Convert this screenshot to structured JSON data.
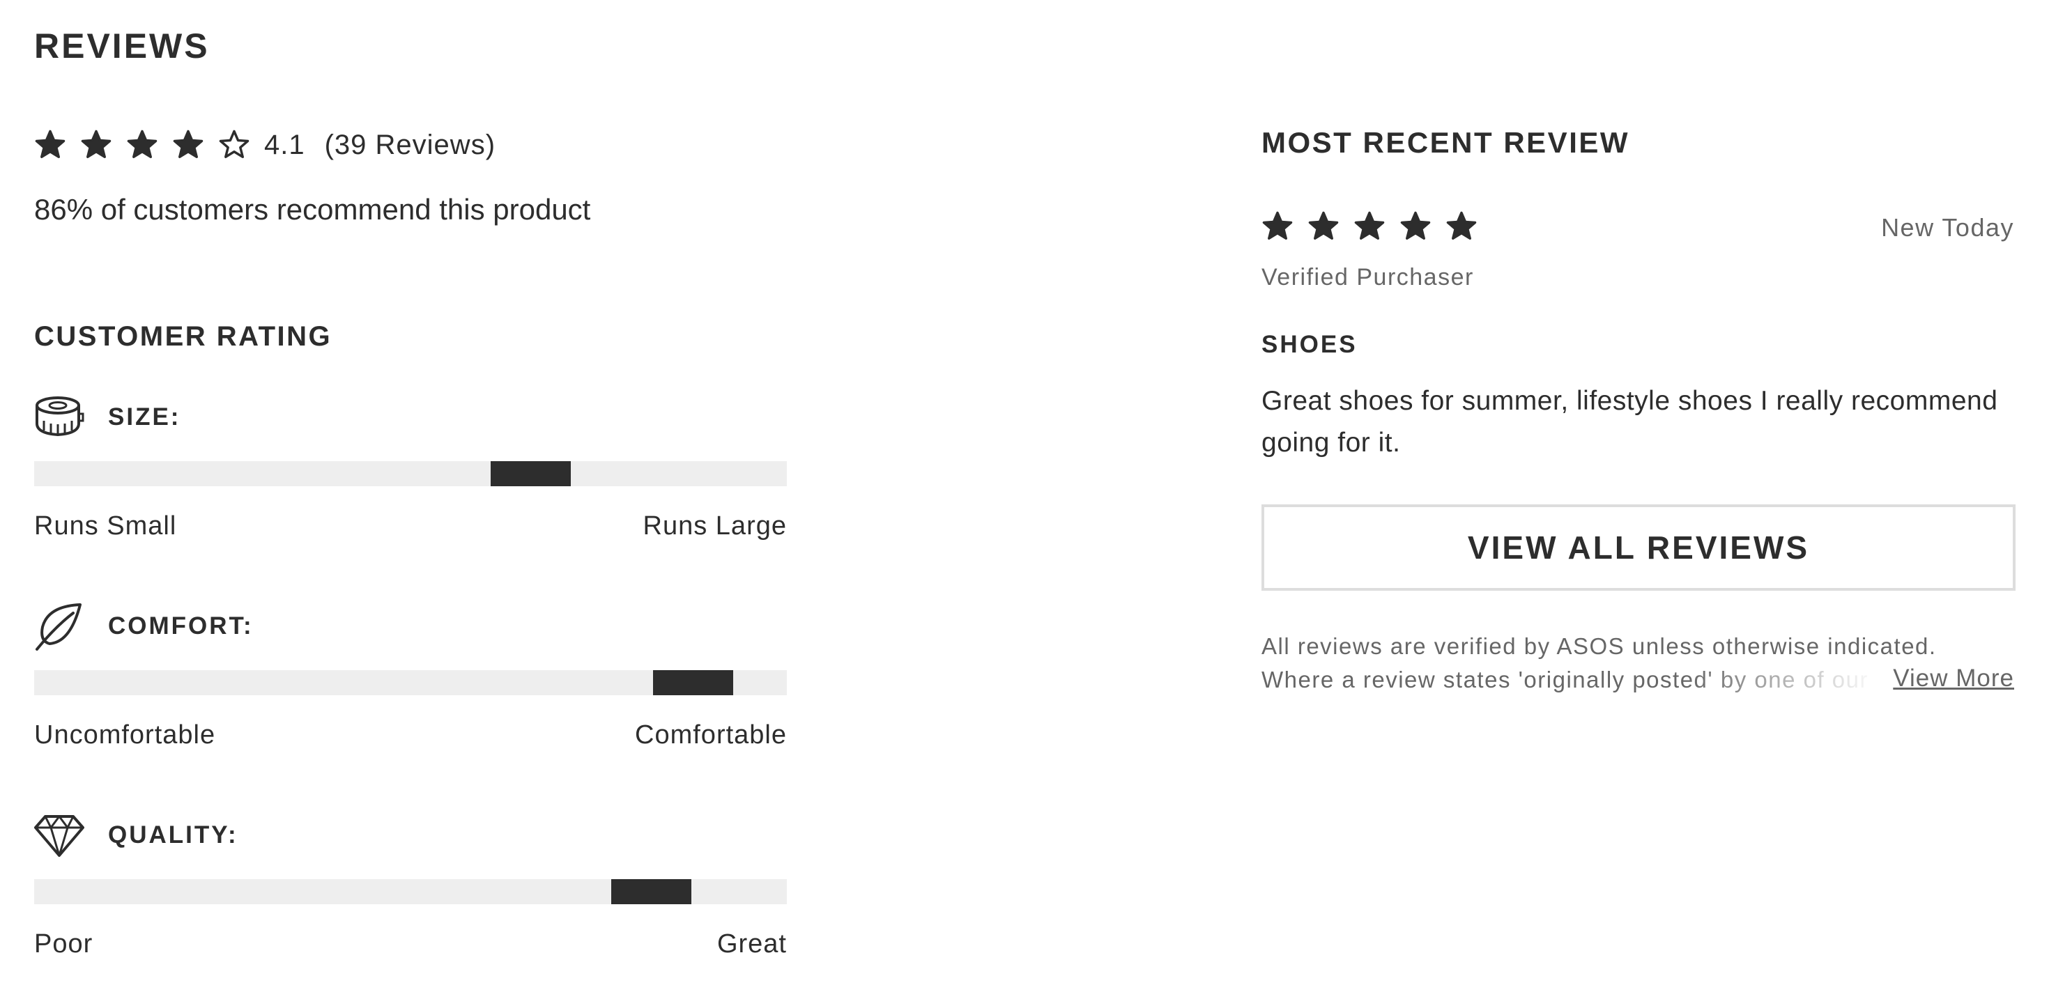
{
  "reviews_title": "REVIEWS",
  "summary": {
    "stars_filled": 4,
    "stars_total": 5,
    "rating": "4.1",
    "count_text": "(39 Reviews)",
    "recommend_text": "86% of customers recommend this product"
  },
  "customer_rating": {
    "heading": "CUSTOMER RATING",
    "metrics": [
      {
        "label": "SIZE:",
        "icon": "tape-measure-icon",
        "left_label": "Runs Small",
        "right_label": "Runs Large",
        "position_fraction": 0.66
      },
      {
        "label": "COMFORT:",
        "icon": "leaf-icon",
        "left_label": "Uncomfortable",
        "right_label": "Comfortable",
        "position_fraction": 0.875
      },
      {
        "label": "QUALITY:",
        "icon": "diamond-icon",
        "left_label": "Poor",
        "right_label": "Great",
        "position_fraction": 0.82
      }
    ]
  },
  "recent_review": {
    "heading": "MOST RECENT REVIEW",
    "stars_filled": 5,
    "date": "New Today",
    "verified": "Verified Purchaser",
    "title": "SHOES",
    "body": "Great shoes for summer, lifestyle shoes I really recommend going for it."
  },
  "view_all_label": "VIEW ALL REVIEWS",
  "disclaimer": "All reviews are verified by ASOS unless otherwise indicated. Where a review states 'originally posted' by one of our",
  "view_more_label": "View More",
  "colors": {
    "text": "#2d2d2d",
    "muted": "#666666",
    "track": "#eeeeee",
    "border": "#dddddd"
  }
}
